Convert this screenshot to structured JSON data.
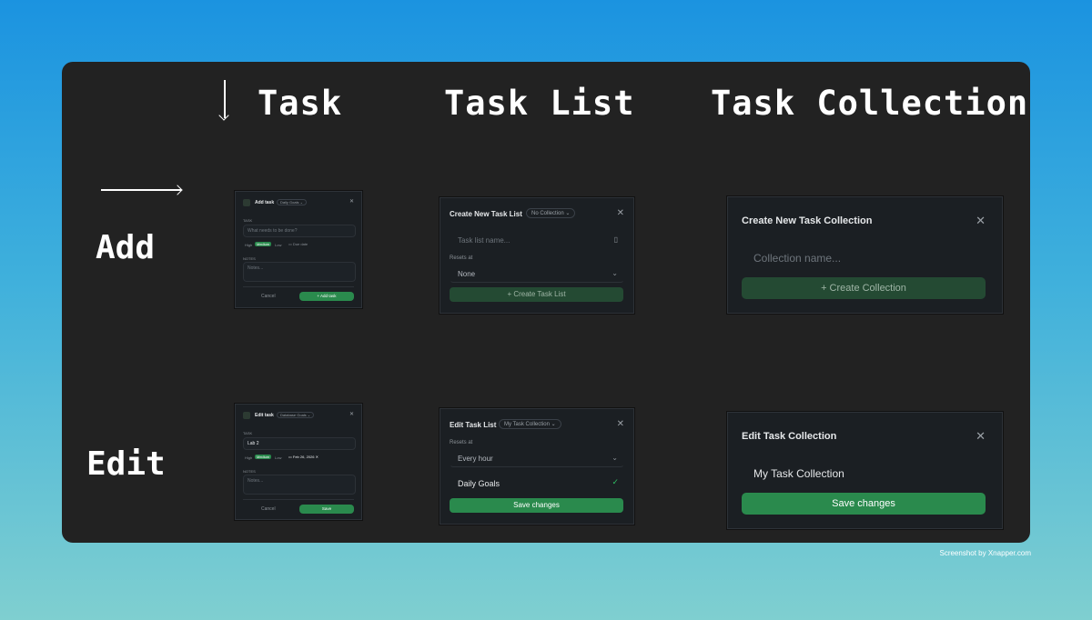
{
  "columns": {
    "task": "Task",
    "task_list": "Task List",
    "task_collection": "Task Collection"
  },
  "rows": {
    "add": "Add",
    "edit": "Edit"
  },
  "credit": "Screenshot by Xnapper.com",
  "add_task": {
    "title": "Add task",
    "collection_pill": "Daily Goals ⌄",
    "task_label": "TASK",
    "task_placeholder": "What needs to be done?",
    "priorities": [
      "High",
      "Medium",
      "Low"
    ],
    "due": "Due date",
    "notes_label": "NOTES",
    "notes_placeholder": "Notes...",
    "cancel": "Cancel",
    "submit": "+ Add task"
  },
  "edit_task": {
    "title": "Edit task",
    "collection_pill": "Database Goals ⌄",
    "task_label": "TASK",
    "task_value": "Lab 2",
    "priorities": [
      "High",
      "Medium",
      "Low"
    ],
    "due": "Feb 26, 2026",
    "notes_label": "NOTES",
    "notes_placeholder": "Notes...",
    "cancel": "Cancel",
    "submit": "Save"
  },
  "create_list": {
    "title": "Create New Task List",
    "collection_pill": "No Collection ⌄",
    "name_placeholder": "Task list name...",
    "resets_label": "Resets at",
    "resets_value": "None",
    "submit": "+ Create Task List"
  },
  "edit_list": {
    "title": "Edit Task List",
    "collection_pill": "My Task Collection ⌄",
    "resets_label": "Resets at",
    "resets_value": "Every hour",
    "item": "Daily Goals",
    "submit": "Save changes"
  },
  "create_collection": {
    "title": "Create New Task Collection",
    "name_placeholder": "Collection name...",
    "submit": "+ Create Collection"
  },
  "edit_collection": {
    "title": "Edit Task Collection",
    "name_value": "My Task Collection",
    "submit": "Save changes"
  },
  "colors": {
    "accent_green": "#2a8a4d",
    "board": "#222222",
    "panel": "#1b1f23"
  }
}
